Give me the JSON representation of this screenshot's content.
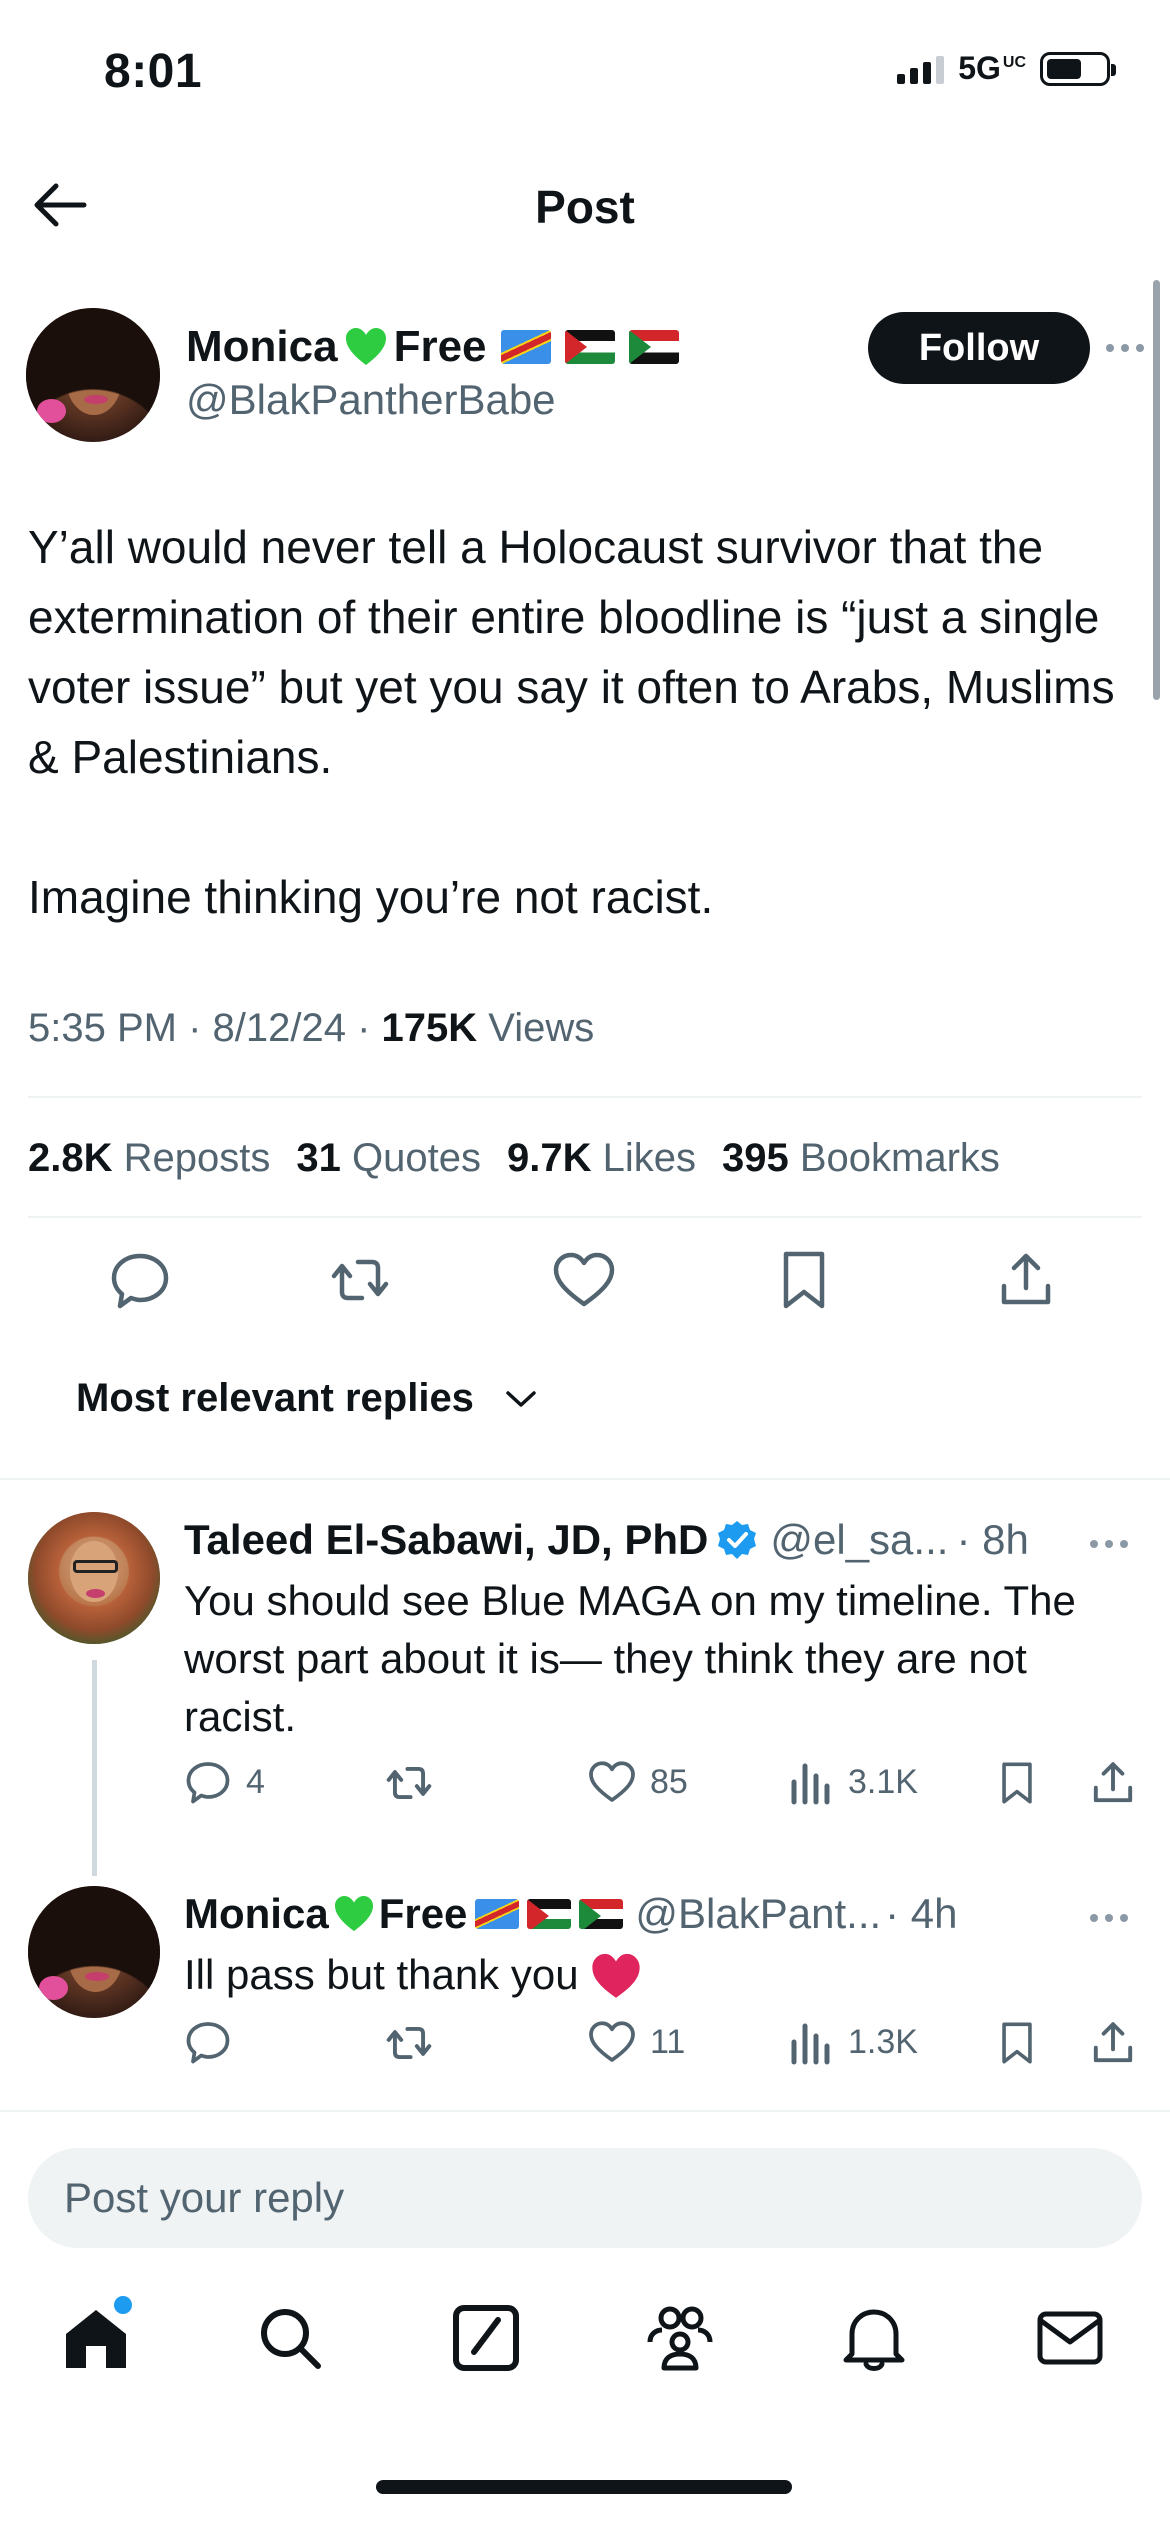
{
  "status_bar": {
    "time": "8:01",
    "network": "5G",
    "network_suffix": "UC"
  },
  "header": {
    "title": "Post"
  },
  "post": {
    "author_name": "Monica",
    "author_name_suffix": "Free",
    "author_handle": "@BlakPantherBabe",
    "follow_label": "Follow",
    "text_paragraph_1": "Y’all would never tell a Holocaust survivor that the extermination of their entire bloodline is “just a single voter issue” but yet you say it often to Arabs, Muslims & Palestinians.",
    "text_paragraph_2": "Imagine thinking you’re not racist.",
    "time": "5:35 PM",
    "date": "8/12/24",
    "views_count": "175K",
    "views_label": "Views",
    "stats": [
      {
        "count": "2.8K",
        "label": "Reposts"
      },
      {
        "count": "31",
        "label": "Quotes"
      },
      {
        "count": "9.7K",
        "label": "Likes"
      },
      {
        "count": "395",
        "label": "Bookmarks"
      }
    ]
  },
  "replies_sort": {
    "label": "Most relevant replies"
  },
  "replies": [
    {
      "name": "Taleed El-Sabawi, JD, PhD",
      "handle": "@el_sa...",
      "time": "· 8h",
      "text": "You should see Blue MAGA on my timeline. The worst part about it is— they think they are not racist.",
      "replies": "4",
      "reposts": "",
      "likes": "85",
      "views": "3.1K"
    },
    {
      "name": "Monica",
      "name_suffix": "Free",
      "handle": "@BlakPant...",
      "time": "· 4h",
      "text": "Ill pass but thank you",
      "replies": "",
      "reposts": "",
      "likes": "11",
      "views": "1.3K"
    }
  ],
  "reply_box": {
    "placeholder": "Post your reply"
  },
  "colors": {
    "accent": "#1d9bf0",
    "text": "#0f1419",
    "muted": "#536471",
    "heart_green": "#2ecc40",
    "heart_red": "#e0245e"
  },
  "icons": [
    "back-arrow-icon",
    "more-icon",
    "reply-icon",
    "repost-icon",
    "like-icon",
    "bookmark-icon",
    "share-icon",
    "views-icon",
    "verified-icon",
    "home-icon",
    "search-icon",
    "compose-icon",
    "communities-icon",
    "notifications-icon",
    "messages-icon",
    "chevron-down-icon"
  ]
}
